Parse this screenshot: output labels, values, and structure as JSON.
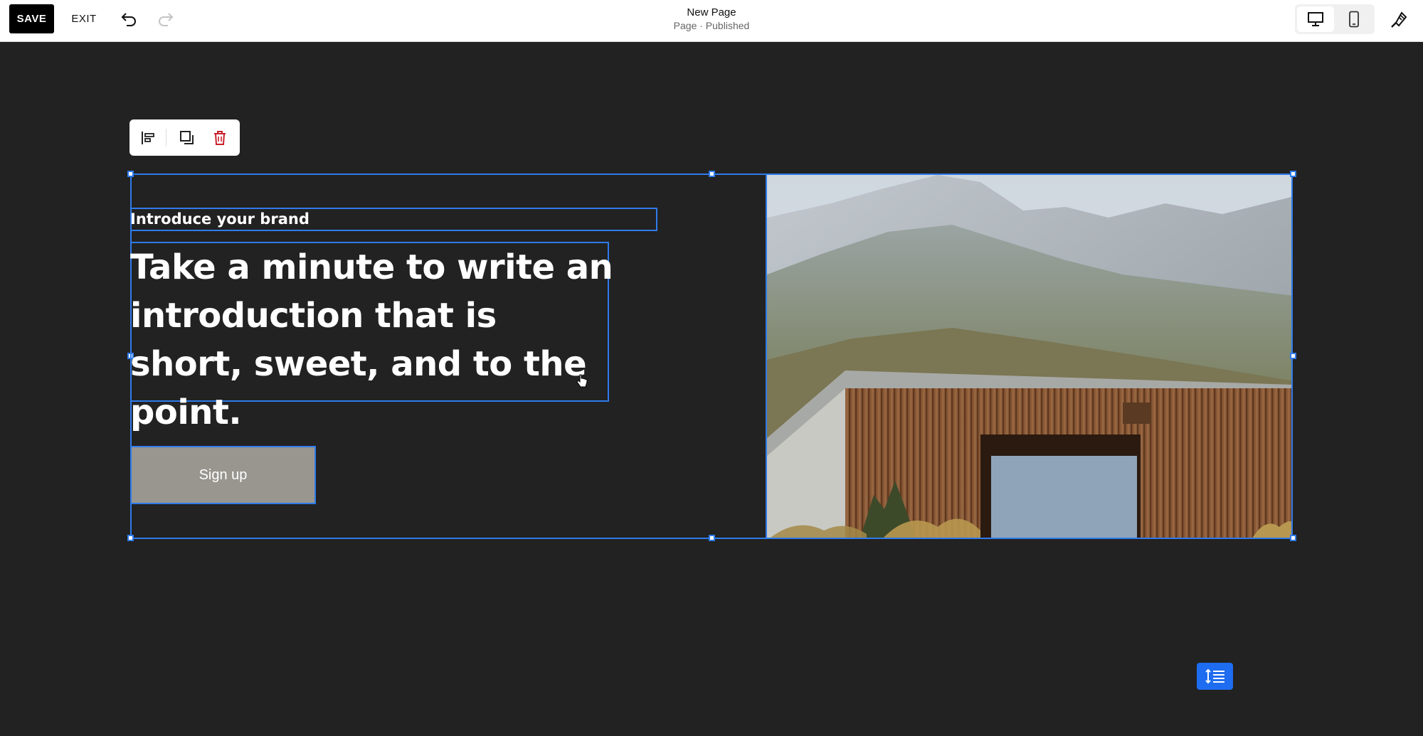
{
  "toolbar": {
    "save_label": "SAVE",
    "exit_label": "EXIT",
    "undo_icon": "undo-icon",
    "redo_icon": "redo-icon"
  },
  "page": {
    "name": "New Page",
    "status": "Page · Published"
  },
  "view_toggle": {
    "desktop_icon": "desktop-icon",
    "mobile_icon": "mobile-icon",
    "active": "desktop"
  },
  "design_icon": "paintbrush-icon",
  "block_toolbar": {
    "align_icon": "align-left-icon",
    "duplicate_icon": "duplicate-icon",
    "delete_icon": "trash-icon"
  },
  "section": {
    "eyebrow": "Introduce your brand",
    "headline": "Take a minute to write an introduction that is short, sweet, and to the point.",
    "button_label": "Sign up"
  },
  "colors": {
    "canvas_bg": "#222222",
    "selection": "#2f7bea",
    "button_bg": "#98968f",
    "delete_red": "#c8202b",
    "spacing_btn": "#1e6cf0"
  }
}
